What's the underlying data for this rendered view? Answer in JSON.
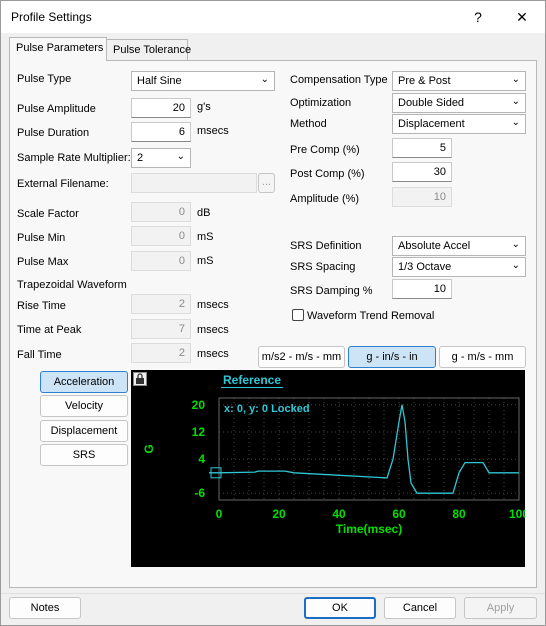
{
  "window": {
    "title": "Profile Settings",
    "help": "?",
    "close": "✕"
  },
  "tabs": [
    {
      "label": "Pulse Parameters"
    },
    {
      "label": "Pulse Tolerance"
    }
  ],
  "left": {
    "pulse_type": {
      "label": "Pulse Type",
      "value": "Half Sine"
    },
    "pulse_amplitude": {
      "label": "Pulse Amplitude",
      "value": "20",
      "unit": "g's"
    },
    "pulse_duration": {
      "label": "Pulse Duration",
      "value": "6",
      "unit": "msecs"
    },
    "sample_rate": {
      "label": "Sample Rate Multiplier:",
      "value": "2"
    },
    "external_filename": {
      "label": "External Filename:",
      "value": "",
      "browse": "..."
    },
    "scale_factor": {
      "label": "Scale Factor",
      "value": "0",
      "unit": "dB"
    },
    "pulse_min": {
      "label": "Pulse Min",
      "value": "0",
      "unit": "mS"
    },
    "pulse_max": {
      "label": "Pulse Max",
      "value": "0",
      "unit": "mS"
    },
    "trapezoidal_heading": "Trapezoidal Waveform",
    "rise_time": {
      "label": "Rise Time",
      "value": "2",
      "unit": "msecs"
    },
    "time_at_peak": {
      "label": "Time at Peak",
      "value": "7",
      "unit": "msecs"
    },
    "fall_time": {
      "label": "Fall Time",
      "value": "2",
      "unit": "msecs"
    }
  },
  "right": {
    "compensation_type": {
      "label": "Compensation Type",
      "value": "Pre & Post"
    },
    "optimization": {
      "label": "Optimization",
      "value": "Double Sided"
    },
    "method": {
      "label": "Method",
      "value": "Displacement"
    },
    "pre_comp": {
      "label": "Pre Comp (%)",
      "value": "5"
    },
    "post_comp": {
      "label": "Post Comp (%)",
      "value": "30"
    },
    "amplitude": {
      "label": "Amplitude (%)",
      "value": "10"
    },
    "srs_definition": {
      "label": "SRS Definition",
      "value": "Absolute Accel"
    },
    "srs_spacing": {
      "label": "SRS Spacing",
      "value": "1/3 Octave"
    },
    "srs_damping": {
      "label": "SRS Damping %",
      "value": "10"
    },
    "waveform_trend_removal": {
      "label": "Waveform Trend Removal",
      "checked": false
    }
  },
  "units_buttons": [
    {
      "label": "m/s2 - m/s - mm",
      "selected": false
    },
    {
      "label": "g - in/s - in",
      "selected": true
    },
    {
      "label": "g - m/s - mm",
      "selected": false
    }
  ],
  "view_buttons": [
    {
      "label": "Acceleration",
      "selected": true
    },
    {
      "label": "Velocity",
      "selected": false
    },
    {
      "label": "Displacement",
      "selected": false
    },
    {
      "label": "SRS",
      "selected": false
    }
  ],
  "plot": {
    "lock_icon": "lock-icon",
    "reference_label": "Reference",
    "readout": "x: 0, y: 0 Locked",
    "colors": {
      "background": "#000000",
      "axis_text": "#00e000",
      "trace": "#2ec7d6",
      "grid": "#444444"
    }
  },
  "chart_data": {
    "type": "line",
    "title": "",
    "xlabel": "Time(msec)",
    "ylabel": "G",
    "xlim": [
      0,
      100
    ],
    "ylim": [
      -8,
      22
    ],
    "xticks": [
      0,
      20,
      40,
      60,
      80,
      100
    ],
    "yticks": [
      20,
      12,
      4,
      -6
    ],
    "grid": true,
    "series": [
      {
        "name": "Reference",
        "x": [
          -5,
          0,
          12,
          13,
          22,
          25,
          56,
          58,
          60,
          61,
          62,
          63,
          64,
          66,
          70,
          78,
          80,
          82,
          88,
          90,
          101
        ],
        "y": [
          0,
          0,
          0.2,
          0.5,
          0.5,
          0,
          -1.5,
          4,
          15,
          20,
          15,
          4,
          -3,
          -6,
          -6,
          -6,
          0,
          3,
          3,
          0,
          0
        ]
      }
    ]
  },
  "footer": {
    "notes": "Notes",
    "ok": "OK",
    "cancel": "Cancel",
    "apply": "Apply"
  }
}
